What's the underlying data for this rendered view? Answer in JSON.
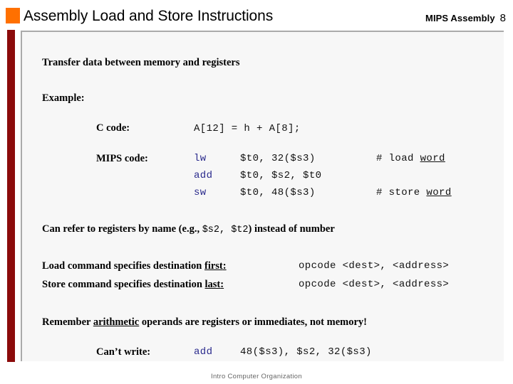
{
  "header": {
    "title": "Assembly Load and Store Instructions",
    "bullet_icon": "orange-square-icon",
    "course_label": "MIPS Assembly",
    "slide_number": "8",
    "accent_orange": "#FF7000",
    "accent_darkred": "#8B0B0B"
  },
  "body": {
    "intro_line": "Transfer data between memory and registers",
    "example_label": "Example:",
    "c_code_label": "C code:",
    "c_code_text": "A[12] = h + A[8];",
    "mips_code_label": "MIPS code:",
    "mips_lines": [
      {
        "mnemonic": "lw",
        "operands": "$t0, 32($s3)",
        "comment_prefix": "# load ",
        "comment_underlined": "word"
      },
      {
        "mnemonic": "add",
        "operands": "$t0, $s2, $t0",
        "comment_prefix": "",
        "comment_underlined": ""
      },
      {
        "mnemonic": "sw",
        "operands": "$t0, 48($s3)",
        "comment_prefix": "# store ",
        "comment_underlined": "word"
      }
    ],
    "register_note_part1": "Can refer to registers by name (e.g., ",
    "register_note_mono": "$s2, $t2",
    "register_note_part2": ") instead of number",
    "rules": [
      {
        "text_prefix": "Load command specifies destination ",
        "text_underlined": "first",
        "text_suffix": ":",
        "syntax": "opcode <dest>, <address>"
      },
      {
        "text_prefix": "Store command specifies destination ",
        "text_underlined": "last",
        "text_suffix": ":",
        "syntax": "opcode <dest>, <address>"
      }
    ],
    "remember_prefix": "Remember ",
    "remember_underlined": "arithmetic",
    "remember_suffix": " operands are registers or immediates, not memory!",
    "cant_write_label": "Can’t write:",
    "cant_write_mnemonic": "add",
    "cant_write_operands": "48($s3), $s2, 32($s3)"
  },
  "footer": {
    "text": "Intro Computer Organization"
  }
}
